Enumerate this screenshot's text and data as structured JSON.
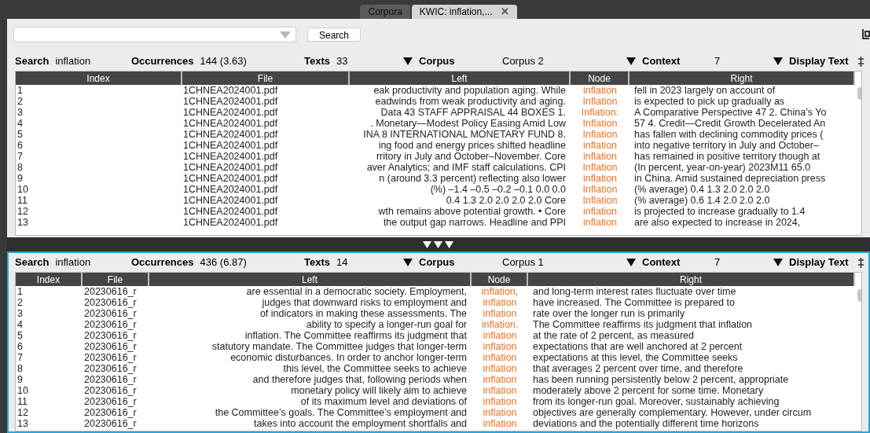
{
  "tabs": [
    {
      "label": "Corpora",
      "selected": false
    },
    {
      "label": "KWIC: inflation,...",
      "selected": true,
      "close": "✕"
    }
  ],
  "search_bar": {
    "button": "Search"
  },
  "panes": [
    {
      "focused": false,
      "search_label": "Search",
      "search_term": "inflation",
      "occurrences_label": "Occurrences",
      "occurrences": "144 (3.63)",
      "texts_label": "Texts",
      "texts": "33",
      "corpus_label": "Corpus",
      "corpus": "Corpus 2",
      "context_label": "Context",
      "context": "7",
      "display_label": "Display Text",
      "columns": [
        "Index",
        "File",
        "Left",
        "Node",
        "Right"
      ],
      "rows": [
        [
          "1",
          "1CHNEA2024001.pdf",
          "eak productivity and population aging. While",
          "inflation",
          "fell in 2023 largely on account of"
        ],
        [
          "2",
          "1CHNEA2024001.pdf",
          "eadwinds from weak productivity and aging.",
          "Inflation",
          "is expected to pick up gradually as"
        ],
        [
          "3",
          "1CHNEA2024001.pdf",
          "Data 43 STAFF APPRAISAL 44 BOXES 1.",
          "Inflation:",
          "A Comparative Perspective 47 2. China’s Yo"
        ],
        [
          "4",
          "1CHNEA2024001.pdf",
          ". Monetary—Modest Policy Easing Amid Low",
          "Inflation",
          "57 4. Credit—Credit Growth Decelerated An"
        ],
        [
          "5",
          "1CHNEA2024001.pdf",
          "INA 8 INTERNATIONAL MONETARY FUND 8.",
          "Inflation",
          "has fallen with declining commodity prices ("
        ],
        [
          "6",
          "1CHNEA2024001.pdf",
          "ing food and energy prices shifted headline",
          "inflation",
          "into negative territory in July and October–"
        ],
        [
          "7",
          "1CHNEA2024001.pdf",
          "rritory in July and October–November. Core",
          "inflation",
          "has remained in positive territory though at"
        ],
        [
          "8",
          "1CHNEA2024001.pdf",
          "aver Analytics; and IMF staff calculations. CPI",
          "Inflation",
          "(In percent, year-on-year) 2023M11 65.0"
        ],
        [
          "9",
          "1CHNEA2024001.pdf",
          "n (around 3.3 percent) reflecting also lower",
          "inflation",
          "in China. Amid sustained depreciation press"
        ],
        [
          "10",
          "1CHNEA2024001.pdf",
          "(%) –1.4 –0.5 –0.2 –0.1 0.0 0.0",
          "Inflation",
          "(% average) 0.4 1.3 2.0 2.0 2.0"
        ],
        [
          "11",
          "1CHNEA2024001.pdf",
          "0.4 1.3 2.0 2.0 2.0 2.0 Core",
          "Inflation",
          "(% average) 0.6 1.4 2.0 2.0 2.0"
        ],
        [
          "12",
          "1CHNEA2024001.pdf",
          "wth remains above potential growth. • Core",
          "inflation",
          "is projected to increase gradually to 1.4"
        ],
        [
          "13",
          "1CHNEA2024001.pdf",
          "the output gap narrows. Headline and PPI",
          "inflation",
          "are also expected to increase in 2024,"
        ]
      ]
    },
    {
      "focused": true,
      "search_label": "Search",
      "search_term": "inflation",
      "occurrences_label": "Occurrences",
      "occurrences": "436 (6.87)",
      "texts_label": "Texts",
      "texts": "14",
      "corpus_label": "Corpus",
      "corpus": "Corpus 1",
      "context_label": "Context",
      "context": "7",
      "display_label": "Display Text",
      "columns": [
        "Index",
        "File",
        "Left",
        "Node",
        "Right"
      ],
      "rows": [
        [
          "1",
          "20230616_r",
          "are essential in a democratic society. Employment,",
          "inflation,",
          "and long-term interest rates fluctuate over time"
        ],
        [
          "2",
          "20230616_r",
          "judges that downward risks to employment and",
          "inflation",
          "have increased. The Committee is prepared to"
        ],
        [
          "3",
          "20230616_r",
          "of indicators in making these assessments. The",
          "inflation",
          "rate over the longer run is primarily"
        ],
        [
          "4",
          "20230616_r",
          "ability to specify a longer-run goal for",
          "inflation.",
          "The Committee reaffirms its judgment that inflation"
        ],
        [
          "5",
          "20230616_r",
          "inflation. The Committee reaffirms its judgment that",
          "inflation",
          "at the rate of 2 percent, as measured"
        ],
        [
          "6",
          "20230616_r",
          "statutory mandate. The Committee judges that longer-term",
          "inflation",
          "expectations that are well anchored at 2 percent"
        ],
        [
          "7",
          "20230616_r",
          "economic disturbances. In order to anchor longer-term",
          "inflation",
          "expectations at this level, the Committee seeks"
        ],
        [
          "8",
          "20230616_r",
          "this level, the Committee seeks to achieve",
          "inflation",
          "that averages 2 percent over time, and therefore"
        ],
        [
          "9",
          "20230616_r",
          "and therefore judges that, following periods when",
          "inflation",
          "has been running persistently below 2 percent, appropriate"
        ],
        [
          "10",
          "20230616_r",
          "monetary policy will likely aim to achieve",
          "inflation",
          "moderately above 2 percent for some time. Monetary"
        ],
        [
          "11",
          "20230616_r",
          "of its maximum level and deviations of",
          "inflation",
          "from its longer-run goal. Moreover, sustainably achieving"
        ],
        [
          "12",
          "20230616_r",
          "the Committee’s goals. The Committee’s employment and",
          "inflation",
          "objectives are generally complementary. However, under circum"
        ],
        [
          "13",
          "20230616_r",
          "takes into account the employment shortfalls and",
          "inflation",
          "deviations and the potentially different time horizons"
        ]
      ]
    }
  ]
}
